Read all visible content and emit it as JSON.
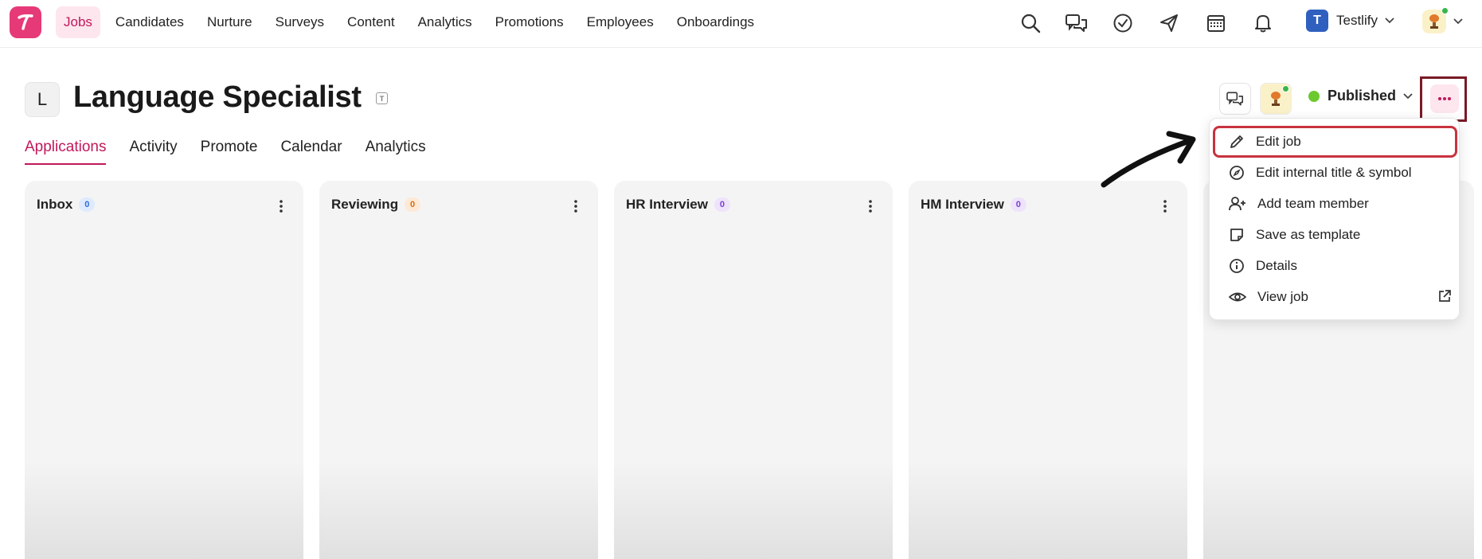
{
  "nav": {
    "logo_letter": "T",
    "items": [
      {
        "label": "Jobs",
        "active": true
      },
      {
        "label": "Candidates"
      },
      {
        "label": "Nurture"
      },
      {
        "label": "Surveys"
      },
      {
        "label": "Content"
      },
      {
        "label": "Analytics"
      },
      {
        "label": "Promotions"
      },
      {
        "label": "Employees"
      },
      {
        "label": "Onboardings"
      }
    ],
    "company": {
      "initial": "T",
      "name": "Testlify"
    },
    "icons": [
      "search-icon",
      "chat-icon",
      "check-circle-icon",
      "send-icon",
      "calendar-icon",
      "bell-icon"
    ]
  },
  "job": {
    "symbol": "L",
    "title": "Language Specialist",
    "title_badge": "T",
    "status": "Published",
    "status_color": "#6bc92f"
  },
  "tabs": [
    {
      "label": "Applications",
      "active": true
    },
    {
      "label": "Activity"
    },
    {
      "label": "Promote"
    },
    {
      "label": "Calendar"
    },
    {
      "label": "Analytics"
    }
  ],
  "columns": [
    {
      "title": "Inbox",
      "count": "0",
      "badge_bg": "#dfeafe",
      "badge_fg": "#2f6fd6"
    },
    {
      "title": "Reviewing",
      "count": "0",
      "badge_bg": "#fde9d6",
      "badge_fg": "#d96b0f"
    },
    {
      "title": "HR Interview",
      "count": "0",
      "badge_bg": "#eee3fb",
      "badge_fg": "#7b3fcf"
    },
    {
      "title": "HM Interview",
      "count": "0",
      "badge_bg": "#eee3fb",
      "badge_fg": "#7b3fcf"
    }
  ],
  "menu": {
    "items": [
      {
        "label": "Edit job",
        "icon": "pencil-icon",
        "highlighted": true
      },
      {
        "label": "Edit internal title & symbol",
        "icon": "compass-icon"
      },
      {
        "label": "Add team member",
        "icon": "user-plus-icon"
      },
      {
        "label": "Save as template",
        "icon": "note-icon"
      },
      {
        "label": "Details",
        "icon": "info-icon"
      },
      {
        "label": "View job",
        "icon": "eye-icon",
        "external": true
      }
    ]
  },
  "colors": {
    "accent": "#c2185b",
    "logo": "#e63977",
    "highlight_border": "#c8323f",
    "more_box_border": "#7a1a26"
  }
}
